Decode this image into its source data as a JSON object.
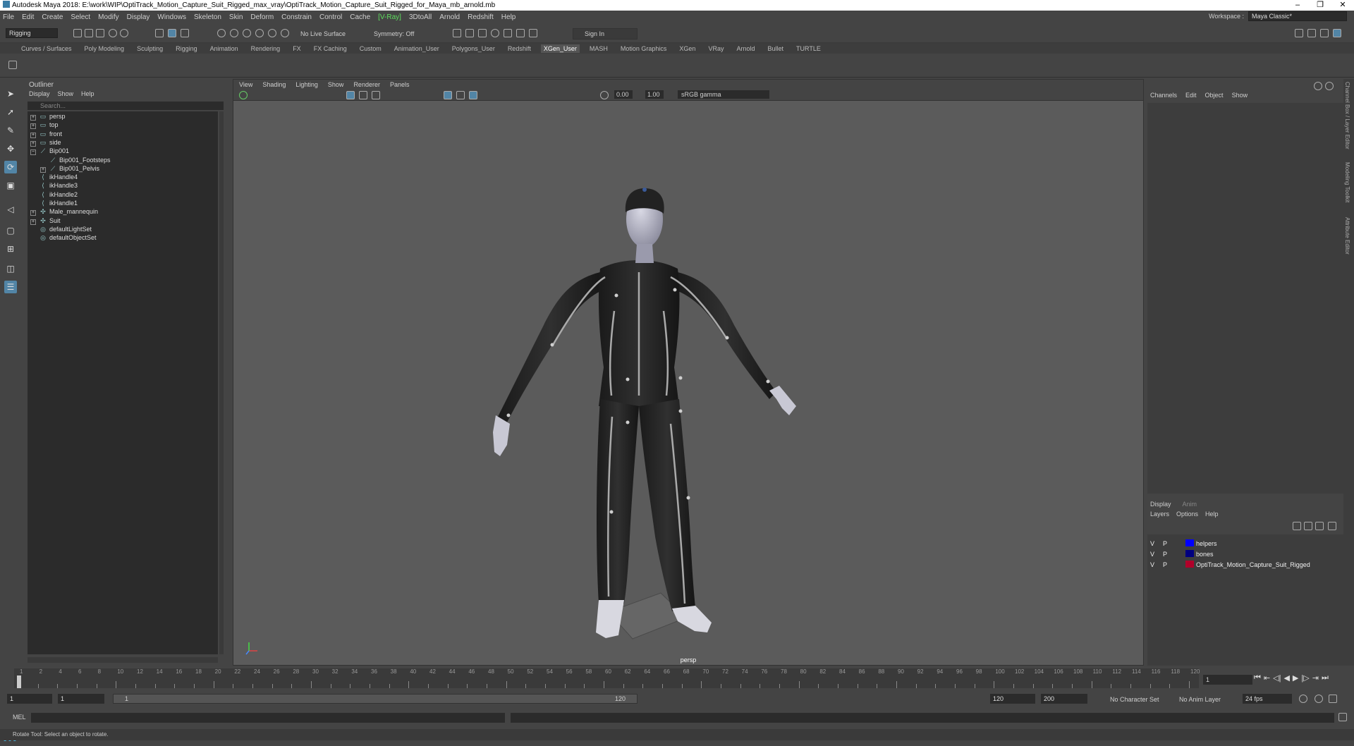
{
  "title": "Autodesk Maya 2018: E:\\work\\WIP\\OptiTrack_Motion_Capture_Suit_Rigged_max_vray\\OptiTrack_Motion_Capture_Suit_Rigged_for_Maya_mb_arnold.mb",
  "window_controls": {
    "minimize": "–",
    "restore": "❐",
    "close": "✕"
  },
  "menus": [
    "File",
    "Edit",
    "Create",
    "Select",
    "Modify",
    "Display",
    "Windows",
    "Skeleton",
    "Skin",
    "Deform",
    "Constrain",
    "Control",
    "Cache"
  ],
  "vray": "[V-Ray]",
  "menus_after": [
    "3DtoAll",
    "Arnold",
    "Redshift",
    "Help"
  ],
  "workspace": {
    "label": "Workspace :",
    "value": "Maya Classic*"
  },
  "status": {
    "mode": "Rigging",
    "live_surface": "No Live Surface",
    "symmetry": "Symmetry: Off",
    "sign_in": "Sign In"
  },
  "shelf_tabs": [
    "Curves / Surfaces",
    "Poly Modeling",
    "Sculpting",
    "Rigging",
    "Animation",
    "Rendering",
    "FX",
    "FX Caching",
    "Custom",
    "Animation_User",
    "Polygons_User",
    "Redshift",
    "XGen_User",
    "MASH",
    "Motion Graphics",
    "XGen",
    "VRay",
    "Arnold",
    "Bullet",
    "TURTLE"
  ],
  "shelf_active": "XGen_User",
  "outliner": {
    "title": "Outliner",
    "menu": [
      "Display",
      "Show",
      "Help"
    ],
    "search_placeholder": "Search...",
    "items": [
      {
        "label": "persp",
        "icon": "camera-icon",
        "indent": 0,
        "expand": "+"
      },
      {
        "label": "top",
        "icon": "camera-icon",
        "indent": 0,
        "expand": "+"
      },
      {
        "label": "front",
        "icon": "camera-icon",
        "indent": 0,
        "expand": "+"
      },
      {
        "label": "side",
        "icon": "camera-icon",
        "indent": 0,
        "expand": "+"
      },
      {
        "label": "Bip001",
        "icon": "joint-icon",
        "indent": 0,
        "expand": "−"
      },
      {
        "label": "Bip001_Footsteps",
        "icon": "joint-icon",
        "indent": 1,
        "expand": ""
      },
      {
        "label": "Bip001_Pelvis",
        "icon": "joint-icon",
        "indent": 1,
        "expand": "+"
      },
      {
        "label": "ikHandle4",
        "icon": "ik-handle-icon",
        "indent": 0,
        "expand": ""
      },
      {
        "label": "ikHandle3",
        "icon": "ik-handle-icon",
        "indent": 0,
        "expand": ""
      },
      {
        "label": "ikHandle2",
        "icon": "ik-handle-icon",
        "indent": 0,
        "expand": ""
      },
      {
        "label": "ikHandle1",
        "icon": "ik-handle-icon",
        "indent": 0,
        "expand": ""
      },
      {
        "label": "Male_mannequin",
        "icon": "transform-icon",
        "indent": 0,
        "expand": "+"
      },
      {
        "label": "Suit",
        "icon": "transform-icon",
        "indent": 0,
        "expand": "+"
      },
      {
        "label": "defaultLightSet",
        "icon": "set-icon",
        "indent": 0,
        "expand": ""
      },
      {
        "label": "defaultObjectSet",
        "icon": "set-icon",
        "indent": 0,
        "expand": ""
      }
    ]
  },
  "viewport": {
    "menu": [
      "View",
      "Shading",
      "Lighting",
      "Show",
      "Renderer",
      "Panels"
    ],
    "exposure": "0.00",
    "gamma_value": "1.00",
    "color_space": "sRGB gamma",
    "camera": "persp"
  },
  "channel_box": {
    "menu": [
      "Channels",
      "Edit",
      "Object",
      "Show"
    ]
  },
  "layer_editor": {
    "tabs": [
      "Display",
      "Anim"
    ],
    "menu": [
      "Layers",
      "Options",
      "Help"
    ],
    "layers": [
      {
        "v": "V",
        "p": "P",
        "name": "helpers",
        "color": "#0000ff"
      },
      {
        "v": "V",
        "p": "P",
        "name": "bones",
        "color": "#000080"
      },
      {
        "v": "V",
        "p": "P",
        "name": "OptiTrack_Motion_Capture_Suit_Rigged",
        "color": "#b0002a"
      }
    ]
  },
  "side_tabs": [
    "Channel Box / Layer Editor",
    "Modeling Toolkit",
    "Attribute Editor"
  ],
  "time_slider": {
    "ticks": [
      "1",
      "2",
      "4",
      "6",
      "8",
      "10",
      "12",
      "14",
      "16",
      "18",
      "20",
      "22",
      "24",
      "26",
      "28",
      "30",
      "32",
      "34",
      "36",
      "38",
      "40",
      "42",
      "44",
      "46",
      "48",
      "50",
      "52",
      "54",
      "56",
      "58",
      "60",
      "62",
      "64",
      "66",
      "68",
      "70",
      "72",
      "74",
      "76",
      "78",
      "80",
      "82",
      "84",
      "86",
      "88",
      "90",
      "92",
      "94",
      "96",
      "98",
      "100",
      "102",
      "104",
      "106",
      "108",
      "110",
      "112",
      "114",
      "116",
      "118",
      "120"
    ],
    "current": "1"
  },
  "range": {
    "start": "1",
    "inner_start": "1",
    "slider_start": "1",
    "slider_end": "120",
    "end": "120",
    "anim_end": "200",
    "character_set": "No Character Set",
    "anim_layer": "No Anim Layer",
    "fps": "24 fps"
  },
  "command": {
    "label": "MEL"
  },
  "help_line": "Rotate Tool: Select an object to rotate."
}
